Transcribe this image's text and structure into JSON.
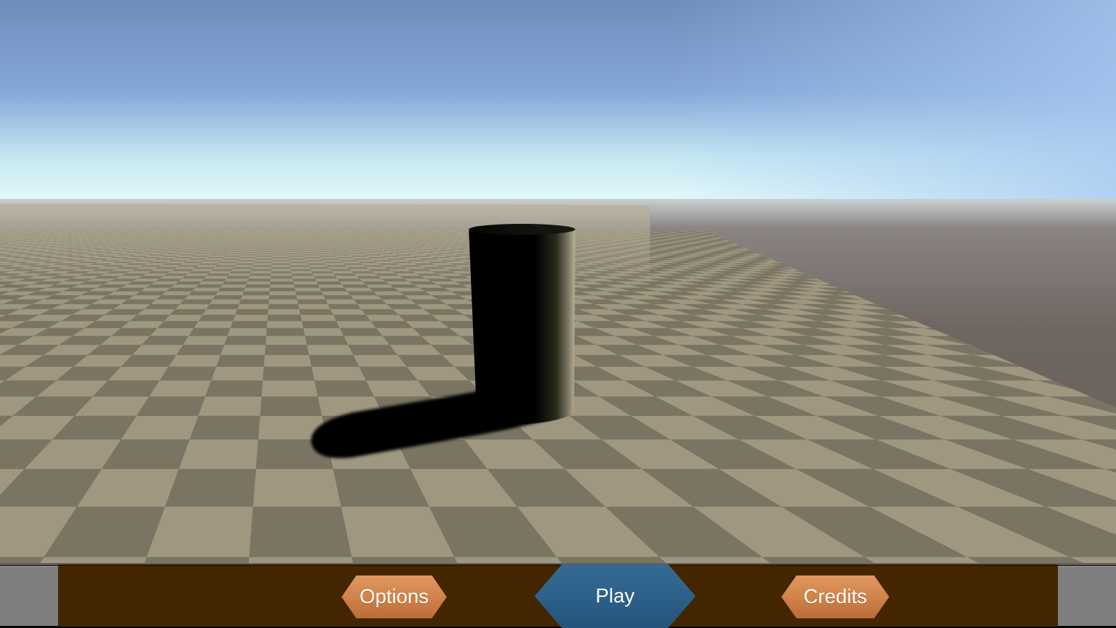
{
  "menu": {
    "options_label": "Options",
    "play_label": "Play",
    "credits_label": "Credits"
  },
  "colors": {
    "sky_top": "#7190bd",
    "sky_horizon": "#e5fbfb",
    "floor_light": "#9f9780",
    "floor_dark": "#7a7562",
    "void_ground": "#6d6460",
    "menu_strip": "#432600",
    "side_panel": "#7f7f7f",
    "button_orange": "#cf8148",
    "button_blue": "#2c6088",
    "button_text": "#ffffff"
  }
}
